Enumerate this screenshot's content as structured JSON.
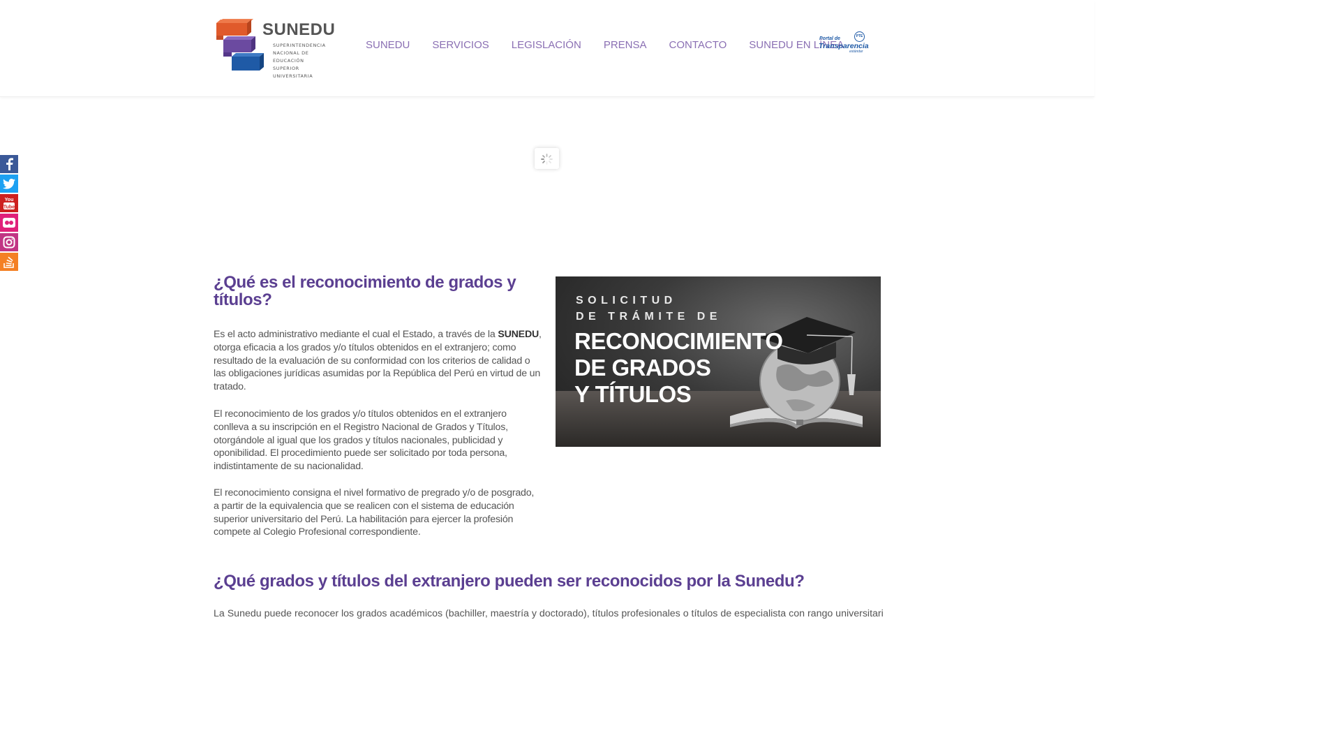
{
  "logo": {
    "name": "SUNEDU",
    "subtitle": [
      "SUPERINTENDENCIA",
      "NACIONAL DE EDUCACIÓN",
      "SUPERIOR UNIVERSITARIA"
    ],
    "colors": {
      "orange": "#e05a2b",
      "purple": "#6b4aa0",
      "blue": "#1f5aa6"
    }
  },
  "nav": {
    "items": [
      "SUNEDU",
      "SERVICIOS",
      "LEGISLACIÓN",
      "PRENSA",
      "CONTACTO",
      "SUNEDU EN LÍNEA"
    ]
  },
  "transparencia": {
    "small": "Portal de",
    "big": "Transparencia",
    "tiny": "estándar",
    "badge": "PTE"
  },
  "social": [
    "facebook-icon",
    "twitter-icon",
    "youtube-icon",
    "flickr-icon",
    "instagram-icon",
    "stackexchange-icon"
  ],
  "section1": {
    "title": "¿Qué es el reconocimiento de grados y títulos?",
    "p1_before": "Es el acto administrativo mediante el cual el Estado, a través de la ",
    "p1_bold": "SUNEDU",
    "p1_after": ", otorga eficacia a los grados y/o títulos obtenidos en el extranjero; como resultado de la evaluación de su conformidad con los criterios de calidad o las obligaciones jurídicas asumidas por la República del Perú en virtud de un tratado.",
    "p2": "El reconocimiento de los grados y/o títulos obtenidos en el extranjero conlleva a su inscripción en el Registro Nacional de Grados y Títulos, otorgándole al igual que los grados y títulos nacionales, publicidad y oponibilidad. El procedimiento puede ser solicitado por toda persona, indistintamente de su nacionalidad.",
    "p3": "El reconocimiento consigna el nivel formativo de pregrado y/o de posgrado, a partir de la equivalencia que se realicen con el sistema de educación superior universitario del Perú. La habilitación para ejercer la profesión compete al Colegio Profesional correspondiente."
  },
  "banner": {
    "line1": "SOLICITUD",
    "line2": "DE TRÁMITE DE",
    "line3": "RECONOCIMIENTO",
    "line4": "DE GRADOS",
    "line5": "Y TÍTULOS"
  },
  "section2": {
    "title": "¿Qué grados y títulos del extranjero pueden ser reconocidos por la Sunedu?",
    "p1": "La Sunedu puede reconocer los grados académicos (bachiller, maestría y doctorado), títulos profesionales o títulos de especialista con rango universitario"
  }
}
